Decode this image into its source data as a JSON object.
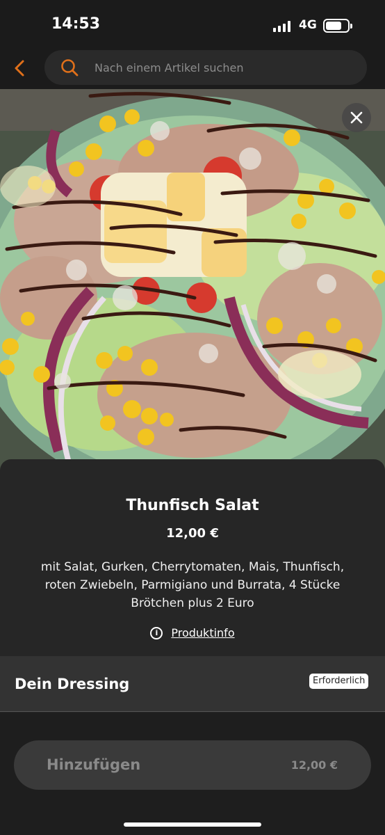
{
  "status": {
    "time": "14:53",
    "network": "4G",
    "battery_level": 0.7
  },
  "search": {
    "placeholder": "Nach einem Artikel suchen"
  },
  "colors": {
    "accent": "#e0701a",
    "sheet": "#262626",
    "section": "#333333",
    "button": "#3a3a3a"
  },
  "icons": {
    "back": "chevron-left-icon",
    "search": "search-icon",
    "close": "close-icon",
    "info": "info-icon"
  },
  "product": {
    "name": "Thunfisch Salat",
    "price": "12,00 €",
    "description": "mit Salat, Gurken, Cherrytomaten, Mais, Thunfisch, roten Zwiebeln, Parmigiano und Burrata, 4 Stücke Brötchen plus 2 Euro",
    "info_link": "Produktinfo"
  },
  "options": {
    "title": "Dein Dressing",
    "badge": "Erforderlich"
  },
  "cart": {
    "add_label": "Hinzufügen",
    "total": "12,00 €"
  }
}
